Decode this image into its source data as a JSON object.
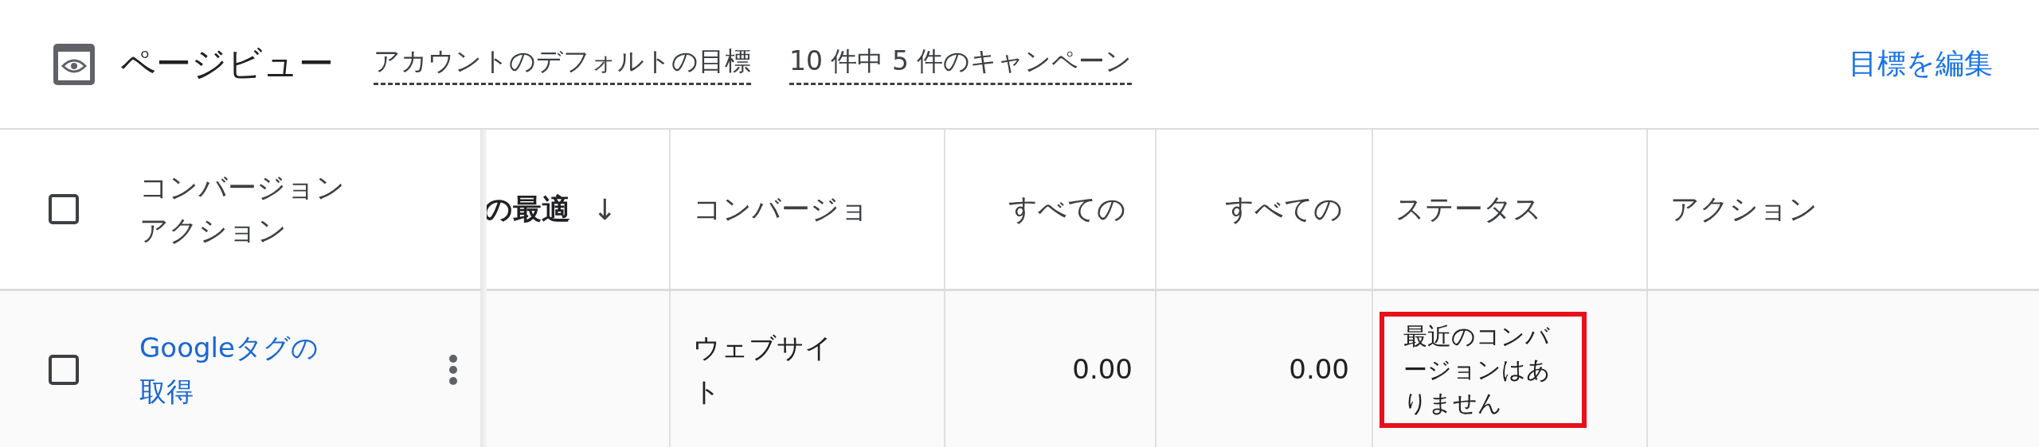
{
  "header": {
    "title": "ページビュー",
    "links": [
      "アカウントのデフォルトの目標",
      "10 件中 5 件のキャンペーン"
    ],
    "edit_button": "目標を編集"
  },
  "table": {
    "select_all": {
      "checked": false
    },
    "columns": [
      {
        "label": "コンバージョンアクション",
        "kind": "text"
      },
      {
        "label": "の最適",
        "kind": "sorted",
        "sort_icon": "↓"
      },
      {
        "label": "コンバージョ",
        "kind": "text"
      },
      {
        "label": "すべての",
        "kind": "numeric"
      },
      {
        "label": "すべての",
        "kind": "numeric"
      },
      {
        "label": "ステータス",
        "kind": "text"
      },
      {
        "label": "アクション",
        "kind": "text"
      }
    ],
    "rows": [
      {
        "checked": false,
        "cells": [
          {
            "text": "Googleタグの取得"
          },
          {
            "text": ""
          },
          {
            "text": "ウェブサイト"
          },
          {
            "text": "0.00"
          },
          {
            "text": "0.00"
          },
          {
            "text": "最近のコンバージョンはありません",
            "highlighted": true
          },
          {
            "text": ""
          }
        ]
      }
    ]
  }
}
